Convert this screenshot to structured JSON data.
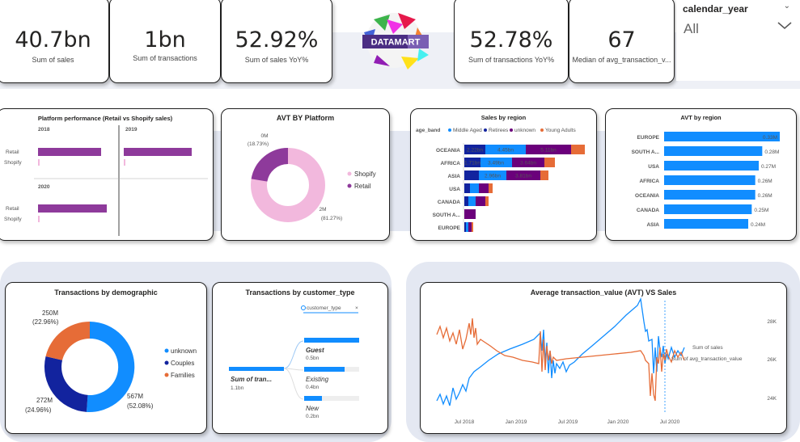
{
  "colors": {
    "retail": "#8e3a9b",
    "shopify": "#f2b8dd",
    "blue": "#118dff",
    "navy": "#12239e",
    "orange": "#e66c37",
    "purple": "#6b007b",
    "magenta": "#e044a7"
  },
  "kpis_left": [
    {
      "value": "40.7bn",
      "label": "Sum of sales"
    },
    {
      "value": "1bn",
      "label": "Sum of transactions"
    },
    {
      "value": "52.92%",
      "label": "Sum of sales YoY%"
    }
  ],
  "kpis_right": [
    {
      "value": "52.78%",
      "label": "Sum of transactions YoY%"
    },
    {
      "value": "67",
      "label": "Median of avg_transaction_v..."
    }
  ],
  "logo": {
    "text": "DATAMART"
  },
  "slicer": {
    "title": "calendar_year",
    "value": "All"
  },
  "platform": {
    "title": "Platform performance (Retail vs Shopify sales)",
    "years": [
      "2018",
      "2019",
      "2020"
    ],
    "rows": [
      "Retail",
      "Shopify"
    ]
  },
  "avt_platform": {
    "title": "AVT BY Platform",
    "legend": [
      "Shopify",
      "Retail"
    ],
    "label_top": "0M",
    "label_top_pct": "(18.73%)",
    "label_bottom": "2M",
    "label_bottom_pct": "(81.27%)"
  },
  "sales_region": {
    "title": "Sales by region",
    "legend_title": "age_band",
    "legend": [
      "Middle Aged",
      "Retirees",
      "unknown",
      "Young Adults"
    ],
    "regions": [
      "OCEANIA",
      "AFRICA",
      "ASIA",
      "USA",
      "CANADA",
      "SOUTH A...",
      "EUROPE"
    ],
    "labels": {
      "oceania": [
        "2.22bn",
        "4.45bn",
        "5.11bn"
      ],
      "africa": [
        "1.71bn",
        "3.49bn",
        "3.64bn"
      ],
      "asia": [
        "2.96bn",
        "3.81bn"
      ]
    }
  },
  "avt_region": {
    "title": "AVT by region",
    "regions": [
      "EUROPE",
      "SOUTH A...",
      "USA",
      "AFRICA",
      "OCEANIA",
      "CANADA",
      "ASIA"
    ],
    "labels": [
      "0.33M",
      "0.28M",
      "0.27M",
      "0.26M",
      "0.26M",
      "0.25M",
      "0.24M"
    ],
    "values": [
      0.33,
      0.28,
      0.27,
      0.26,
      0.26,
      0.25,
      0.24
    ]
  },
  "demographic": {
    "title": "Transactions by demographic",
    "legend": [
      "unknown",
      "Couples",
      "Families"
    ],
    "l1": "250M",
    "l1p": "(22.96%)",
    "l2": "272M",
    "l2p": "(24.96%)",
    "l3": "567M",
    "l3p": "(52.08%)"
  },
  "customer_type": {
    "title": "Transactions by customer_type",
    "filter_label": "customer_type",
    "root_label": "Sum of tran...",
    "root_value": "1.1bn",
    "nodes": [
      {
        "label": "Guest",
        "value": "0.5bn"
      },
      {
        "label": "Existing",
        "value": "0.4bn"
      },
      {
        "label": "New",
        "value": "0.2bn"
      }
    ]
  },
  "avt_sales": {
    "title": "Average transaction_value (AVT) VS Sales",
    "legend": [
      "Sum of sales",
      "Sum of avg_transaction_value"
    ],
    "x_ticks": [
      "Jul 2018",
      "Jan 2019",
      "Jul 2019",
      "Jan 2020",
      "Jul 2020"
    ],
    "y_ticks": [
      "28K",
      "26K",
      "24K"
    ]
  }
}
